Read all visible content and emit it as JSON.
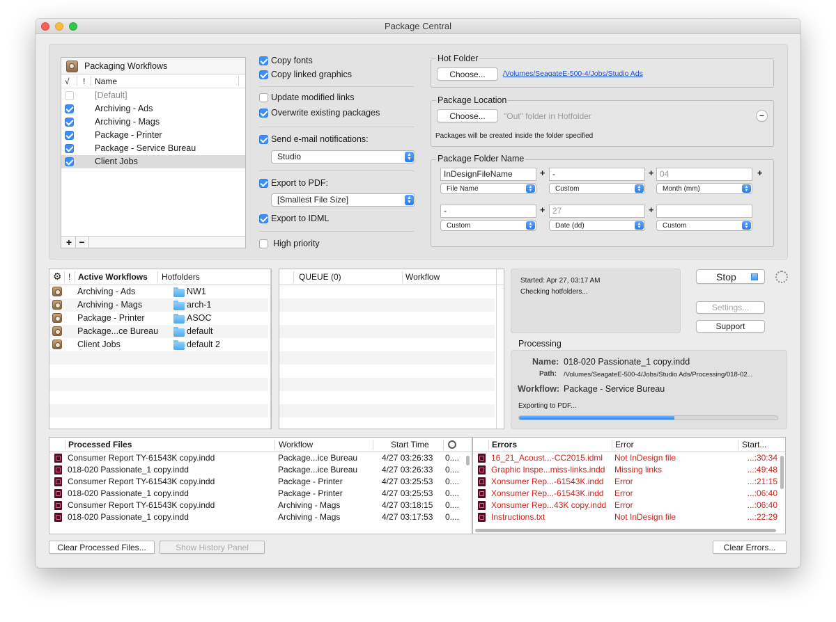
{
  "window": {
    "title": "Package Central"
  },
  "workflows_list": {
    "title": "Packaging Workflows",
    "col_check": "√",
    "col_flag": "!",
    "col_name": "Name",
    "items": [
      {
        "name": "[Default]",
        "checked": false
      },
      {
        "name": "Archiving - Ads",
        "checked": true
      },
      {
        "name": "Archiving - Mags",
        "checked": true
      },
      {
        "name": "Package - Printer",
        "checked": true
      },
      {
        "name": "Package - Service Bureau",
        "checked": true
      },
      {
        "name": "Client Jobs",
        "checked": true
      }
    ],
    "add": "+",
    "remove": "−"
  },
  "options": {
    "copy_fonts": "Copy fonts",
    "copy_linked": "Copy linked graphics",
    "update_links": "Update modified links",
    "overwrite": "Overwrite existing packages",
    "send_email": "Send e-mail notifications:",
    "email_value": "Studio",
    "export_pdf": "Export to PDF:",
    "pdf_preset": "[Smallest File Size]",
    "export_idml": "Export to IDML",
    "high_priority": "High priority"
  },
  "hot_folder": {
    "title": "Hot Folder",
    "choose": "Choose...",
    "path_parts": [
      "/Volumes",
      "/SeagateE-500-4",
      "/Jobs",
      "/Studio Ads"
    ]
  },
  "package_location": {
    "title": "Package Location",
    "choose": "Choose...",
    "value": "\"Out\" folder in Hotfolder",
    "remove": "−",
    "note": "Packages will be created inside the folder specified"
  },
  "folder_name": {
    "title": "Package Folder Name",
    "plus": "+",
    "fields": [
      {
        "text": "InDesignFileName",
        "select": "File Name",
        "gray": false
      },
      {
        "text": "-",
        "select": "Custom",
        "gray": false
      },
      {
        "text": "04",
        "select": "Month (mm)",
        "gray": true
      },
      {
        "text": "-",
        "select": "Custom",
        "gray": false
      },
      {
        "text": "27",
        "select": "Date (dd)",
        "gray": true
      },
      {
        "text": "",
        "select": "Custom",
        "gray": false
      }
    ]
  },
  "active": {
    "col_flag": "!",
    "col_name": "Active Workflows",
    "col_hot": "Hotfolders",
    "rows": [
      {
        "name": "Archiving - Ads",
        "folder": "NW1"
      },
      {
        "name": "Archiving - Mags",
        "folder": "arch-1"
      },
      {
        "name": "Package - Printer",
        "folder": "ASOC"
      },
      {
        "name": "Package...ce Bureau",
        "folder": "default"
      },
      {
        "name": "Client Jobs",
        "folder": "default 2"
      }
    ]
  },
  "queue": {
    "col_queue": "QUEUE (0)",
    "col_workflow": "Workflow"
  },
  "status": {
    "started": "Started: Apr 27, 03:17 AM",
    "checking": "Checking hotfolders..."
  },
  "controls": {
    "stop": "Stop",
    "settings": "Settings...",
    "support": "Support"
  },
  "processing": {
    "title": "Processing",
    "name_label": "Name:",
    "name_value": "018-020 Passionate_1 copy.indd",
    "path_label": "Path:",
    "path_value": "/Volumes/SeagateE-500-4/Jobs/Studio Ads/Processing/018-02...",
    "workflow_label": "Workflow:",
    "workflow_value": "Package - Service Bureau",
    "step": "Exporting to PDF...",
    "progress": 0.6
  },
  "processed": {
    "col_file": "Processed Files",
    "col_workflow": "Workflow",
    "col_start": "Start Time",
    "rows": [
      {
        "file": "Consumer Report TY-61543K copy.indd",
        "workflow": "Package...ice Bureau",
        "start": "4/27 03:26:33",
        "extra": "0...."
      },
      {
        "file": "018-020 Passionate_1 copy.indd",
        "workflow": "Package...ice Bureau",
        "start": "4/27 03:26:33",
        "extra": "0...."
      },
      {
        "file": "Consumer Report TY-61543K copy.indd",
        "workflow": "Package - Printer",
        "start": "4/27 03:25:53",
        "extra": "0...."
      },
      {
        "file": "018-020 Passionate_1 copy.indd",
        "workflow": "Package - Printer",
        "start": "4/27 03:25:53",
        "extra": "0...."
      },
      {
        "file": "Consumer Report TY-61543K copy.indd",
        "workflow": "Archiving - Mags",
        "start": "4/27 03:18:15",
        "extra": "0...."
      },
      {
        "file": "018-020 Passionate_1 copy.indd",
        "workflow": "Archiving - Mags",
        "start": "4/27 03:17:53",
        "extra": "0...."
      }
    ]
  },
  "errors": {
    "col_file": "Errors",
    "col_error": "Error",
    "col_start": "Start...",
    "rows": [
      {
        "file": "16_21_Acoust...-CC2015.idml",
        "error": "Not InDesign file",
        "start": "...:30:34"
      },
      {
        "file": "Graphic Inspe...miss-links.indd",
        "error": "Missing links",
        "start": "...:49:48"
      },
      {
        "file": "Xonsumer Rep...-61543K.indd",
        "error": "Error",
        "start": "...:21:15"
      },
      {
        "file": "Xonsumer Rep...-61543K.indd",
        "error": "Error",
        "start": "...:06:40"
      },
      {
        "file": "Xonsumer Rep...43K copy.indd",
        "error": "Error",
        "start": "...:06:40"
      },
      {
        "file": "Instructions.txt",
        "error": "Not InDesign file",
        "start": "...:22:29"
      }
    ]
  },
  "bottom": {
    "clear_processed": "Clear Processed Files...",
    "show_history": "Show History Panel",
    "clear_errors": "Clear Errors..."
  }
}
